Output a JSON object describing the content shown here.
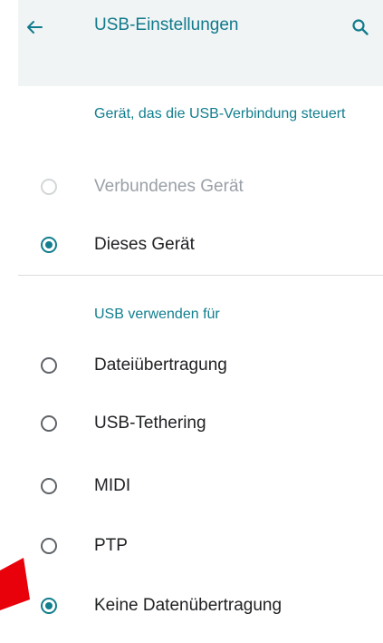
{
  "app_bar": {
    "title": "USB-Einstellungen",
    "back_icon": "arrow-back-icon",
    "search_icon": "search-icon"
  },
  "sections": [
    {
      "title": "Gerät, das die USB-Verbindung steuert",
      "options": [
        {
          "label": "Verbundenes Gerät",
          "checked": false,
          "disabled": true
        },
        {
          "label": "Dieses Gerät",
          "checked": true,
          "disabled": false
        }
      ]
    },
    {
      "title": "USB verwenden für",
      "options": [
        {
          "label": "Dateiübertragung",
          "checked": false,
          "disabled": false
        },
        {
          "label": "USB-Tethering",
          "checked": false,
          "disabled": false
        },
        {
          "label": "MIDI",
          "checked": false,
          "disabled": false
        },
        {
          "label": "PTP",
          "checked": false,
          "disabled": false
        },
        {
          "label": "Keine Datenübertragung",
          "checked": true,
          "disabled": false
        }
      ]
    }
  ],
  "colors": {
    "accent": "#127e8e",
    "app_bar_background": "#f0f4f5",
    "pointer_arrow": "#e8000b"
  }
}
